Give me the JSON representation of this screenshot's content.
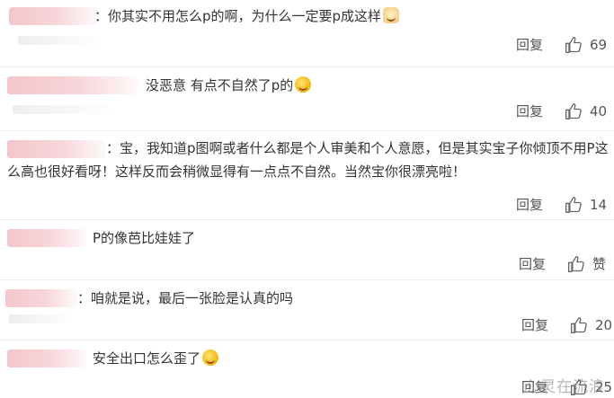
{
  "comments": [
    {
      "text": "：你其实不用怎么p的啊，为什么一定要p成这样",
      "emoji": "cat",
      "reply": "回复",
      "likes": "69"
    },
    {
      "text": "没恶意 有点不自然了p的",
      "emoji": "smile",
      "reply": "回复",
      "likes": "40"
    },
    {
      "text": "：宝，我知道p图啊或者什么都是个人审美和个人意愿，但是其实宝子你倾顶不用P这么高也很好看呀！这样反而会稍微显得有一点点不自然。当然宝你很漂亮啦！",
      "reply": "回复",
      "likes": "14"
    },
    {
      "text": "P的像芭比娃娃了",
      "reply": "回复",
      "likes": "赞"
    },
    {
      "text": "：咱就是说，最后一张脸是认真的吗",
      "reply": "回复",
      "likes": "20"
    },
    {
      "text": "安全出口怎么歪了",
      "emoji": "smile",
      "reply": "回复",
      "likes": "25"
    }
  ],
  "watermark": "心灵在流浪"
}
